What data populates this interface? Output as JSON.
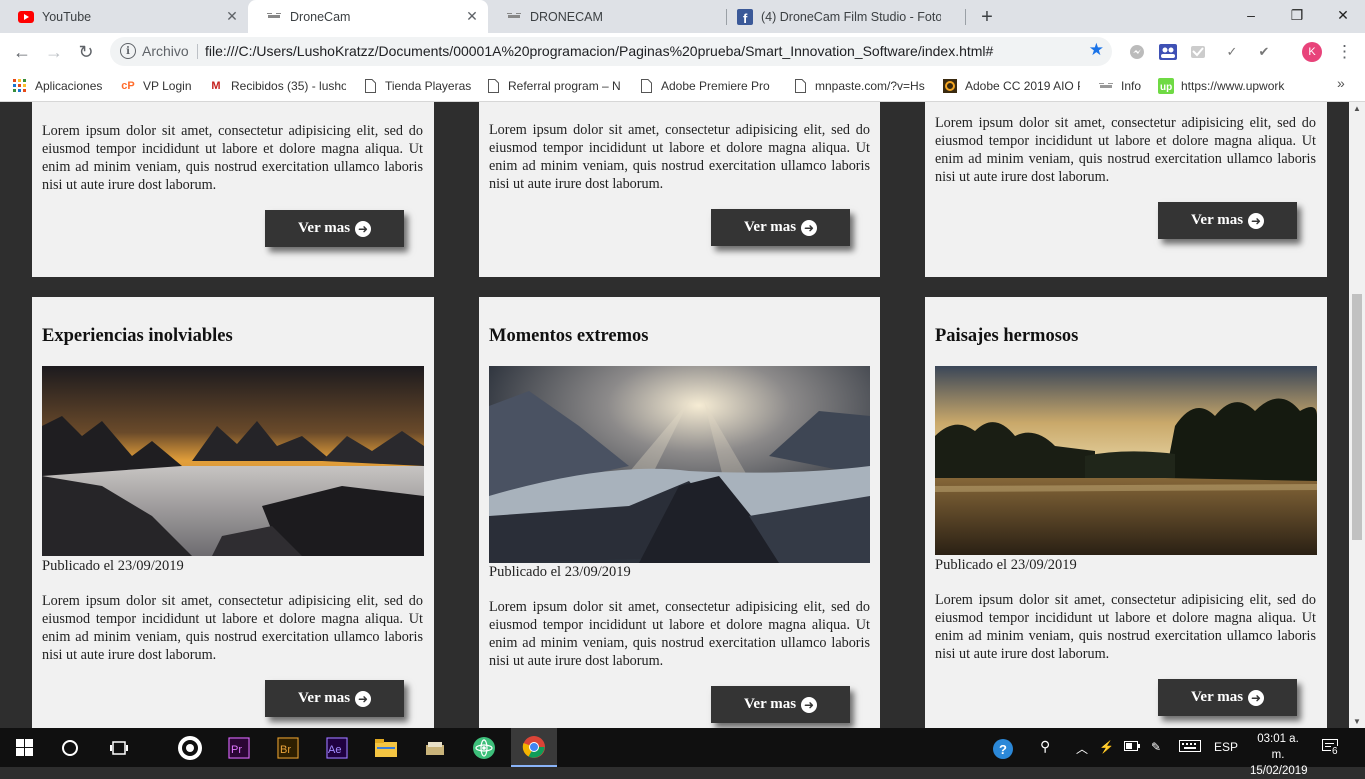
{
  "browser": {
    "tabs": [
      {
        "title": "YouTube",
        "icon": "youtube-icon",
        "active": false
      },
      {
        "title": "DroneCam",
        "icon": "dronecam-icon",
        "active": true
      },
      {
        "title": "DRONECAM",
        "icon": "dronecam-icon",
        "active": false
      },
      {
        "title": "(4) DroneCam Film Studio - Foto",
        "icon": "facebook-icon",
        "active": false
      }
    ],
    "new_tab": "+",
    "window_controls": [
      "–",
      "❐",
      "✕"
    ],
    "address": {
      "scheme_label": "Archivo",
      "url": "file:///C:/Users/LushoKratzz/Documents/00001A%20programacion/Paginas%20prueba/Smart_Innovation_Software/index.html#"
    },
    "profile_initial": "K",
    "bookmarks": [
      {
        "label": "Aplicaciones",
        "icon": "apps-grid-icon"
      },
      {
        "label": "VP Login",
        "icon": "cpanel-icon"
      },
      {
        "label": "Recibidos (35) - lusho",
        "icon": "gmail-icon"
      },
      {
        "label": "Tienda Playeras",
        "icon": "page-icon"
      },
      {
        "label": "Referral program – N",
        "icon": "page-icon"
      },
      {
        "label": "Adobe Premiere Pro C",
        "icon": "page-icon"
      },
      {
        "label": "mnpaste.com/?v=Hs",
        "icon": "page-icon"
      },
      {
        "label": "Adobe CC 2019 AIO P",
        "icon": "adobe-cc-icon"
      },
      {
        "label": "Info",
        "icon": "info-bookmark-icon"
      },
      {
        "label": "https://www.upwork",
        "icon": "upwork-icon"
      }
    ],
    "bookmarks_more": "»"
  },
  "page": {
    "lorem": "Lorem ipsum dolor sit amet, consectetur adipisicing elit, sed do eiusmod tempor incididunt ut labore et dolore magna aliqua. Ut enim ad minim veniam, quis nostrud exercitation ullamco laboris nisi ut aute irure dost laborum.",
    "button_label": "Ver mas",
    "top_row": [
      {
        "description": "Lorem ipsum dolor sit amet, consectetur adipisicing elit, sed do eiusmod tempor incididunt ut labore et dolore magna aliqua. Ut enim ad minim veniam, quis nostrud exercitation ullamco laboris nisi ut aute irure dost laborum.",
        "button": "Ver mas"
      },
      {
        "description": "Lorem ipsum dolor sit amet, consectetur adipisicing elit, sed do eiusmod tempor incididunt ut labore et dolore magna aliqua. Ut enim ad minim veniam, quis nostrud exercitation ullamco laboris nisi ut aute irure dost laborum.",
        "button": "Ver mas"
      },
      {
        "description": "Lorem ipsum dolor sit amet, consectetur adipisicing elit, sed do eiusmod tempor incididunt ut labore et dolore magna aliqua. Ut enim ad minim veniam, quis nostrud exercitation ullamco laboris nisi ut aute irure dost laborum.",
        "button": "Ver mas"
      }
    ],
    "cards": [
      {
        "title": "Experiencias inolviables",
        "date": "Publicado el 23/09/2019",
        "description": "Lorem ipsum dolor sit amet, consectetur adipisicing elit, sed do eiusmod tempor incididunt ut labore et dolore magna aliqua. Ut enim ad minim veniam, quis nostrud exercitation ullamco laboris nisi ut aute irure dost laborum.",
        "button": "Ver mas"
      },
      {
        "title": "Momentos extremos",
        "date": "Publicado el 23/09/2019",
        "description": "Lorem ipsum dolor sit amet, consectetur adipisicing elit, sed do eiusmod tempor incididunt ut labore et dolore magna aliqua. Ut enim ad minim veniam, quis nostrud exercitation ullamco laboris nisi ut aute irure dost laborum.",
        "button": "Ver mas"
      },
      {
        "title": "Paisajes hermosos",
        "date": "Publicado el 23/09/2019",
        "description": "Lorem ipsum dolor sit amet, consectetur adipisicing elit, sed do eiusmod tempor incididunt ut labore et dolore magna aliqua. Ut enim ad minim veniam, quis nostrud exercitation ullamco laboris nisi ut aute irure dost laborum.",
        "button": "Ver mas"
      }
    ]
  },
  "taskbar": {
    "language": "ESP",
    "time": "03:01 a. m.",
    "date": "15/02/2019",
    "notifications": "6",
    "apps": [
      "windows-start-icon",
      "cortana-icon",
      "task-view-icon",
      "obs-icon",
      "premiere-icon",
      "bridge-icon",
      "after-effects-icon",
      "file-explorer-icon",
      "folder-app-icon",
      "atom-icon",
      "chrome-icon"
    ]
  },
  "colors": {
    "page_bg": "#2e2e2e",
    "card_bg": "#f1f1f1",
    "button_bg": "#343434",
    "accent": "#1a73e8"
  }
}
